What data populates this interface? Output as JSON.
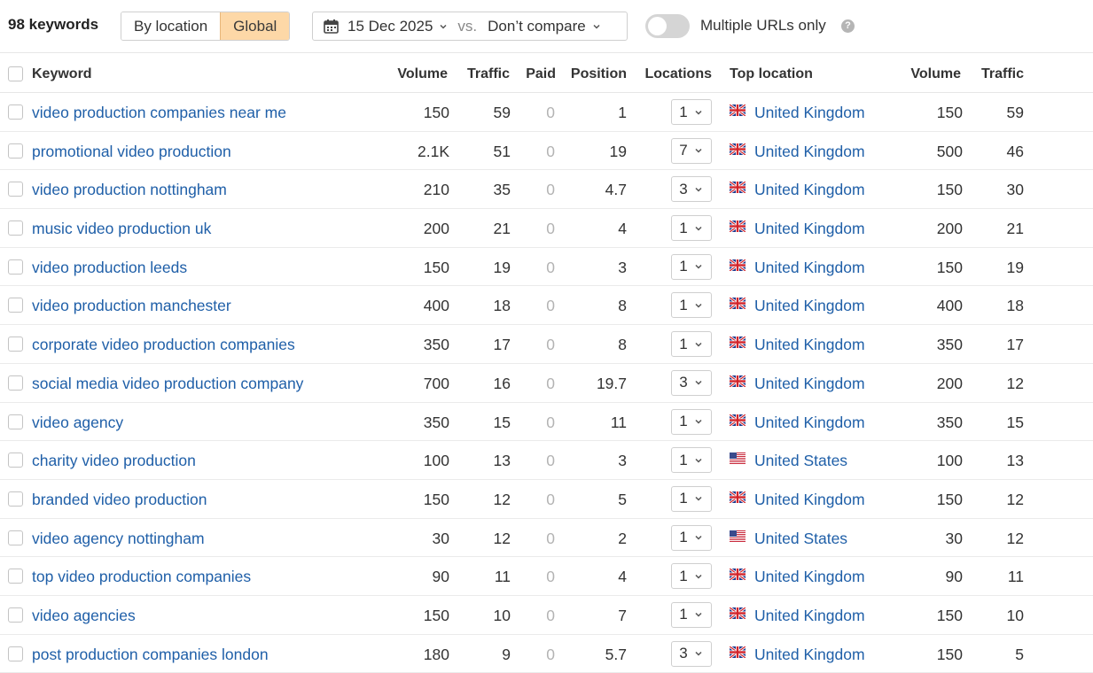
{
  "toolbar": {
    "keyword_count": "98 keywords",
    "scope_options": [
      "By location",
      "Global"
    ],
    "scope_active": "Global",
    "date": "15 Dec 2025",
    "vs": "vs.",
    "compare": "Don’t compare",
    "toggle_label": "Multiple URLs only",
    "toggle_on": false,
    "help": "?"
  },
  "columns": {
    "keyword": "Keyword",
    "volume": "Volume",
    "traffic": "Traffic",
    "paid": "Paid",
    "position": "Position",
    "locations": "Locations",
    "top_location": "Top location",
    "loc_volume": "Volume",
    "loc_traffic": "Traffic"
  },
  "rows": [
    {
      "keyword": "video production companies near me",
      "volume": "150",
      "traffic": "59",
      "paid": "0",
      "position": "1",
      "locations": "1",
      "flag": "uk-flag-icon",
      "top_location": "United Kingdom",
      "loc_volume": "150",
      "loc_traffic": "59"
    },
    {
      "keyword": "promotional video production",
      "volume": "2.1K",
      "traffic": "51",
      "paid": "0",
      "position": "19",
      "locations": "7",
      "flag": "uk-flag-icon",
      "top_location": "United Kingdom",
      "loc_volume": "500",
      "loc_traffic": "46"
    },
    {
      "keyword": "video production nottingham",
      "volume": "210",
      "traffic": "35",
      "paid": "0",
      "position": "4.7",
      "locations": "3",
      "flag": "uk-flag-icon",
      "top_location": "United Kingdom",
      "loc_volume": "150",
      "loc_traffic": "30"
    },
    {
      "keyword": "music video production uk",
      "volume": "200",
      "traffic": "21",
      "paid": "0",
      "position": "4",
      "locations": "1",
      "flag": "uk-flag-icon",
      "top_location": "United Kingdom",
      "loc_volume": "200",
      "loc_traffic": "21"
    },
    {
      "keyword": "video production leeds",
      "volume": "150",
      "traffic": "19",
      "paid": "0",
      "position": "3",
      "locations": "1",
      "flag": "uk-flag-icon",
      "top_location": "United Kingdom",
      "loc_volume": "150",
      "loc_traffic": "19"
    },
    {
      "keyword": "video production manchester",
      "volume": "400",
      "traffic": "18",
      "paid": "0",
      "position": "8",
      "locations": "1",
      "flag": "uk-flag-icon",
      "top_location": "United Kingdom",
      "loc_volume": "400",
      "loc_traffic": "18"
    },
    {
      "keyword": "corporate video production companies",
      "volume": "350",
      "traffic": "17",
      "paid": "0",
      "position": "8",
      "locations": "1",
      "flag": "uk-flag-icon",
      "top_location": "United Kingdom",
      "loc_volume": "350",
      "loc_traffic": "17"
    },
    {
      "keyword": "social media video production company",
      "volume": "700",
      "traffic": "16",
      "paid": "0",
      "position": "19.7",
      "locations": "3",
      "flag": "uk-flag-icon",
      "top_location": "United Kingdom",
      "loc_volume": "200",
      "loc_traffic": "12"
    },
    {
      "keyword": "video agency",
      "volume": "350",
      "traffic": "15",
      "paid": "0",
      "position": "11",
      "locations": "1",
      "flag": "uk-flag-icon",
      "top_location": "United Kingdom",
      "loc_volume": "350",
      "loc_traffic": "15"
    },
    {
      "keyword": "charity video production",
      "volume": "100",
      "traffic": "13",
      "paid": "0",
      "position": "3",
      "locations": "1",
      "flag": "us-flag-icon",
      "top_location": "United States",
      "loc_volume": "100",
      "loc_traffic": "13"
    },
    {
      "keyword": "branded video production",
      "volume": "150",
      "traffic": "12",
      "paid": "0",
      "position": "5",
      "locations": "1",
      "flag": "uk-flag-icon",
      "top_location": "United Kingdom",
      "loc_volume": "150",
      "loc_traffic": "12"
    },
    {
      "keyword": "video agency nottingham",
      "volume": "30",
      "traffic": "12",
      "paid": "0",
      "position": "2",
      "locations": "1",
      "flag": "us-flag-icon",
      "top_location": "United States",
      "loc_volume": "30",
      "loc_traffic": "12"
    },
    {
      "keyword": "top video production companies",
      "volume": "90",
      "traffic": "11",
      "paid": "0",
      "position": "4",
      "locations": "1",
      "flag": "uk-flag-icon",
      "top_location": "United Kingdom",
      "loc_volume": "90",
      "loc_traffic": "11"
    },
    {
      "keyword": "video agencies",
      "volume": "150",
      "traffic": "10",
      "paid": "0",
      "position": "7",
      "locations": "1",
      "flag": "uk-flag-icon",
      "top_location": "United Kingdom",
      "loc_volume": "150",
      "loc_traffic": "10"
    },
    {
      "keyword": "post production companies london",
      "volume": "180",
      "traffic": "9",
      "paid": "0",
      "position": "5.7",
      "locations": "3",
      "flag": "uk-flag-icon",
      "top_location": "United Kingdom",
      "loc_volume": "150",
      "loc_traffic": "5"
    }
  ],
  "colors": {
    "link": "#1f5fa8",
    "active_segment": "#fdd8a7",
    "paid_zero": "#b3b3b3"
  }
}
